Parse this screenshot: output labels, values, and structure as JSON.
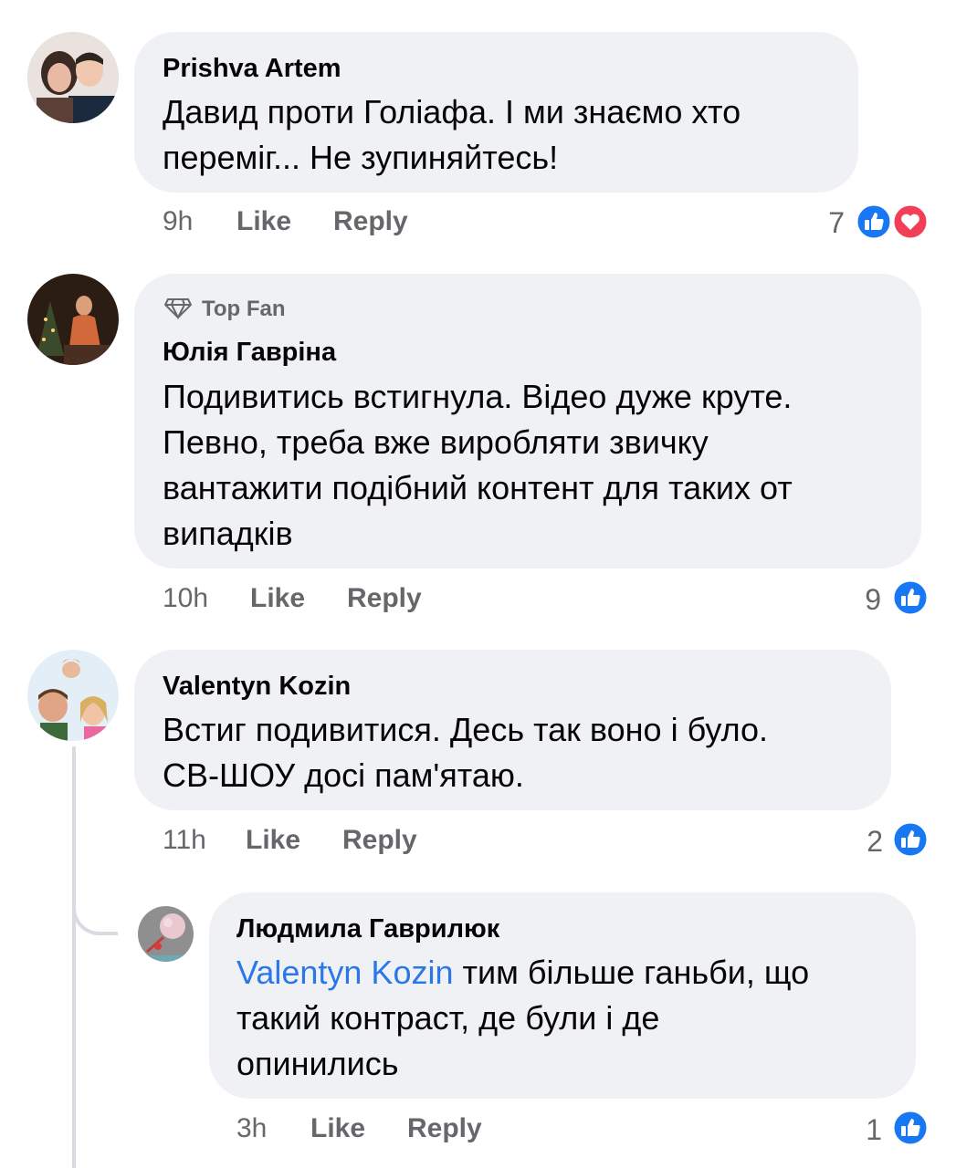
{
  "comments": [
    {
      "author": "Prishva Artem",
      "text_lines": [
        "Давид проти Голіафа.  І ми знаємо хто",
        "переміг... Не зупиняйтесь!"
      ],
      "time": "9h",
      "like_label": "Like",
      "reply_label": "Reply",
      "reaction_count": "7",
      "reactions": [
        "like-icon",
        "love-icon"
      ]
    },
    {
      "badge": "Top Fan",
      "author": "Юлія Гавріна",
      "text_lines": [
        "Подивитись встигнула. Відео дуже круте.",
        "Певно, треба вже виробляти звичку",
        "вантажити подібний контент для таких от",
        "випадків"
      ],
      "time": "10h",
      "like_label": "Like",
      "reply_label": "Reply",
      "reaction_count": "9",
      "reactions": [
        "like-icon"
      ]
    },
    {
      "author": "Valentyn Kozin",
      "text_lines": [
        "Встиг подивитися. Десь так воно і було.",
        "СВ-ШОУ досі пам'ятаю."
      ],
      "time": "11h",
      "like_label": "Like",
      "reply_label": "Reply",
      "reaction_count": "2",
      "reactions": [
        "like-icon"
      ]
    },
    {
      "author": "Людмила Гаврилюк",
      "mention": "Valentyn Kozin",
      "text_first": " тим більше ганьби, що",
      "text_lines": [
        "такий контраст, де були і де",
        "опинились"
      ],
      "time": "3h",
      "like_label": "Like",
      "reply_label": "Reply",
      "reaction_count": "1",
      "reactions": [
        "like-icon"
      ]
    }
  ],
  "colors": {
    "like": "#1877f2",
    "love": "#f33e58",
    "mention": "#2a78e8",
    "bubble": "#f0f1f5"
  }
}
